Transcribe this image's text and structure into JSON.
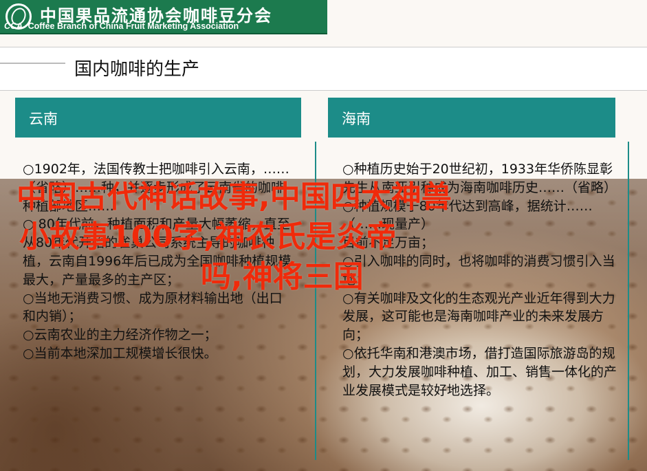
{
  "header": {
    "org_cn": "中国果品流通协会咖啡豆分会",
    "org_abbr": "CCA",
    "org_en": "Coffee Branch of China Fruit Marketing Association"
  },
  "page_title": "国内咖啡的生产",
  "panels": [
    {
      "heading": "云南",
      "items": [
        "○1902年，法国传教士把咖啡引入云南，……（省略）……种，并逐步形成了云南省的咖啡种植部地区……",
        "○ 80年代前，种植面积和产量大幅萎缩，直至从80年代开始的雀巢公司系统主导的咖啡种植，云南自1996年后已成为全国咖啡种植规模最大，产量最多的主产区；",
        "○当地无消费习惯、成为原材料输出地（出口和内销）；",
        "○云南农业的主力经济作物之一；",
        "○当前本地深加工规模增长很快。"
      ]
    },
    {
      "heading": "海南",
      "items": [
        "○种植历史始于20世纪初，1933年华侨陈显彰先生从南亚引种成为海南咖啡历史……（省略）",
        "○种植规模于80年代达到高峰，据统计……（……现量产）",
        "目前不足万亩；",
        "○引入咖啡的同时，也将咖啡的消费习惯引入当地；",
        "○有关咖啡及文化的生态观光产业近年得到大力发展，这可能也是海南咖啡产业的未来发展方向；",
        "○依托华南和港澳市场，借打造国际旅游岛的规划，大力发展咖啡种植、加工、销售一体化的产业发展模式是较好地选择。"
      ]
    }
  ],
  "overlay": {
    "line1": "中国古代神话故事,中国四大神兽",
    "line2": "小故事100字,神农氏是炎帝",
    "line3": "吗,神将三国"
  },
  "colors": {
    "header_green": "#1c7a4e",
    "panel_teal": "#1c8c88",
    "overlay_red": "#f02a0a"
  }
}
